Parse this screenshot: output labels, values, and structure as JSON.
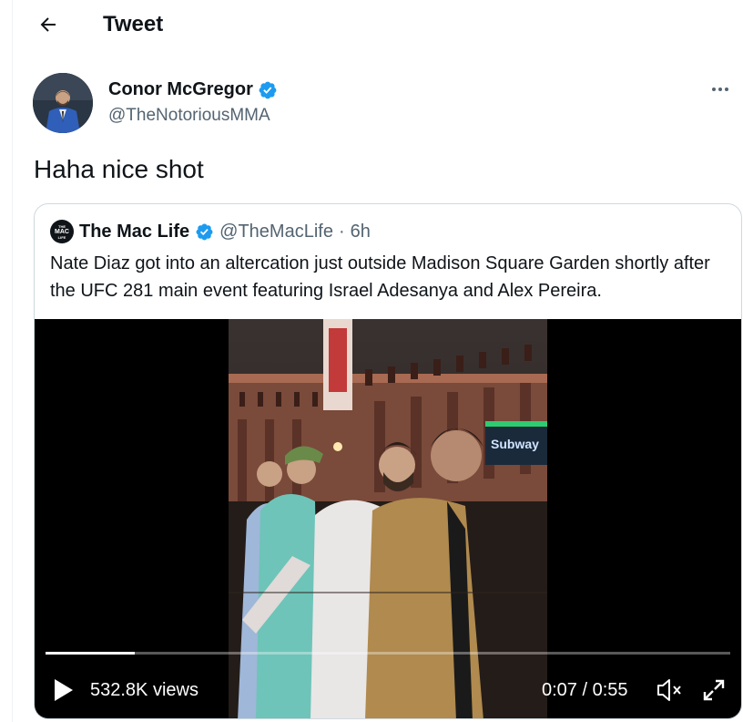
{
  "header": {
    "title": "Tweet",
    "back_icon": "arrow-left-icon"
  },
  "author": {
    "name": "Conor McGregor",
    "handle": "@TheNotoriousMMA",
    "verified_icon": "verified-badge-icon",
    "more_icon": "more-horizontal-icon"
  },
  "tweet": {
    "text": "Haha nice shot"
  },
  "quoted_tweet": {
    "logo_text_top": "THE",
    "logo_text_main": "MAC",
    "logo_text_bottom": "LIFE",
    "name": "The Mac Life",
    "handle": "@TheMacLife",
    "separator": "·",
    "time": "6h",
    "text": "Nate Diaz got into an altercation just outside Madison Square Garden shortly after the UFC 281 main event featuring Israel Adesanya and Alex Pereira.",
    "video": {
      "views": "532.8K views",
      "time": "0:07 / 0:55",
      "progress_fraction": 0.13,
      "sign_text": "Subway",
      "play_icon": "play-icon",
      "mute_icon": "volume-muted-icon",
      "fullscreen_icon": "fullscreen-icon"
    }
  },
  "colors": {
    "verified": "#1d9bf0",
    "secondary_text": "#536471",
    "border": "#cfd9de"
  }
}
